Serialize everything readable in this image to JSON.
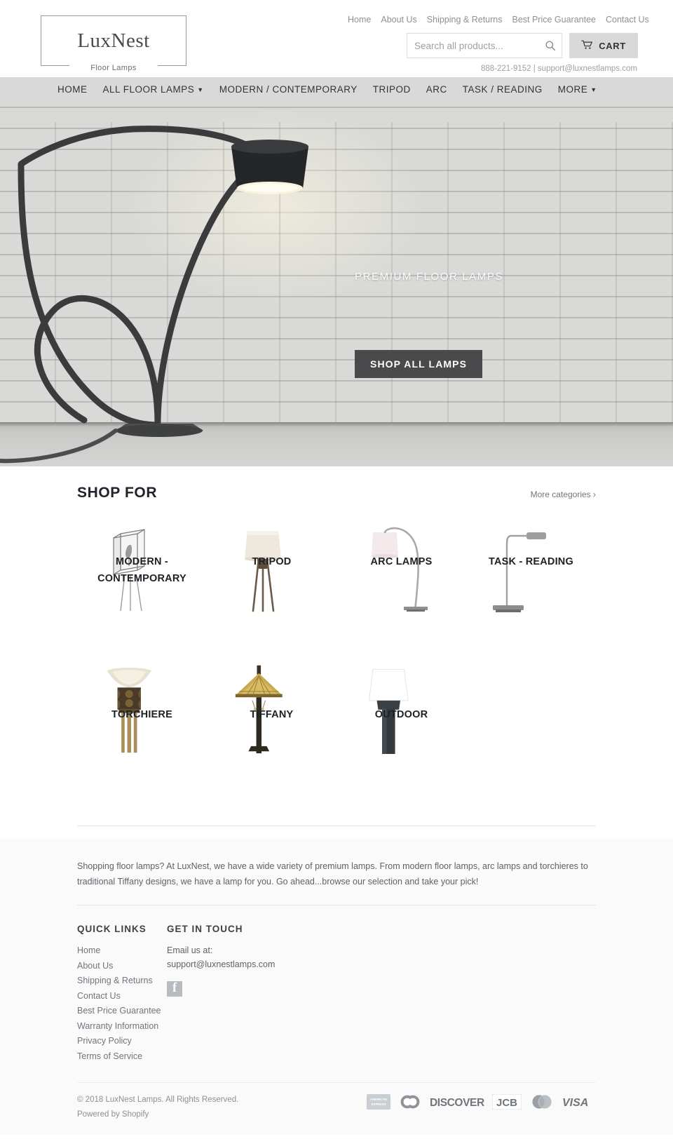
{
  "header": {
    "logo_word": "LuxNest",
    "logo_sub": "Floor Lamps",
    "top_links": [
      {
        "label": "Home"
      },
      {
        "label": "About Us"
      },
      {
        "label": "Shipping & Returns"
      },
      {
        "label": "Best Price Guarantee"
      },
      {
        "label": "Contact Us"
      }
    ],
    "search": {
      "placeholder": "Search all products...",
      "value": "",
      "icon": "search-icon"
    },
    "cart": {
      "label": "CART",
      "icon": "cart-icon"
    },
    "contact_line": "888-221-9152 | support@luxnestlamps.com"
  },
  "main_nav": [
    {
      "label": "HOME",
      "caret": false
    },
    {
      "label": "ALL FLOOR LAMPS",
      "caret": true
    },
    {
      "label": "MODERN / CONTEMPORARY",
      "caret": false
    },
    {
      "label": "TRIPOD",
      "caret": false
    },
    {
      "label": "ARC",
      "caret": false
    },
    {
      "label": "TASK / READING",
      "caret": false
    },
    {
      "label": "MORE",
      "caret": true
    }
  ],
  "hero": {
    "headline": "PREMIUM FLOOR LAMPS",
    "button_label": "SHOP ALL LAMPS"
  },
  "shop": {
    "title": "SHOP FOR",
    "more_link": "More categories ›",
    "row1": [
      {
        "label": "MODERN - CONTEMPORARY",
        "art": "modern-lamp"
      },
      {
        "label": "TRIPOD",
        "art": "tripod-lamp"
      },
      {
        "label": "ARC LAMPS",
        "art": "arc-lamp"
      },
      {
        "label": "TASK - READING",
        "art": "task-lamp"
      }
    ],
    "row2": [
      {
        "label": "TORCHIERE",
        "art": "torchiere-lamp"
      },
      {
        "label": "TIFFANY",
        "art": "tiffany-lamp"
      },
      {
        "label": "OUTDOOR",
        "art": "outdoor-lamp"
      }
    ]
  },
  "blurb": "Shopping floor lamps? At LuxNest, we have a wide variety of premium lamps. From modern floor lamps, arc lamps and torchieres to traditional Tiffany designs, we have a lamp for you. Go ahead...browse our selection and take your pick!",
  "footer": {
    "quick_links_heading": "QUICK LINKS",
    "quick_links": [
      {
        "label": "Home"
      },
      {
        "label": "About Us"
      },
      {
        "label": "Shipping & Returns"
      },
      {
        "label": "Contact Us"
      },
      {
        "label": "Best Price Guarantee"
      },
      {
        "label": "Warranty Information"
      },
      {
        "label": "Privacy Policy"
      },
      {
        "label": "Terms of Service"
      }
    ],
    "get_in_touch_heading": "GET IN TOUCH",
    "email_label": "Email us at:",
    "email": "support@luxnestlamps.com",
    "social": [
      {
        "name": "facebook-icon"
      }
    ],
    "copyright": "© 2018 LuxNest Lamps. All Rights Reserved.",
    "powered_by": "Powered by Shopify",
    "payment_icons": [
      {
        "name": "american-express",
        "label": "AMERICAN EXPRESS"
      },
      {
        "name": "diners-club",
        "label": "Diners Club"
      },
      {
        "name": "discover",
        "label": "DISCOVER"
      },
      {
        "name": "jcb",
        "label": "JCB"
      },
      {
        "name": "mastercard",
        "label": "Mastercard"
      },
      {
        "name": "visa",
        "label": "VISA"
      }
    ]
  },
  "colors": {
    "nav_bg": "#d9d9d9",
    "hero_button": "#4a4a4c",
    "text": "#3d4246",
    "muted": "#8c9196"
  }
}
